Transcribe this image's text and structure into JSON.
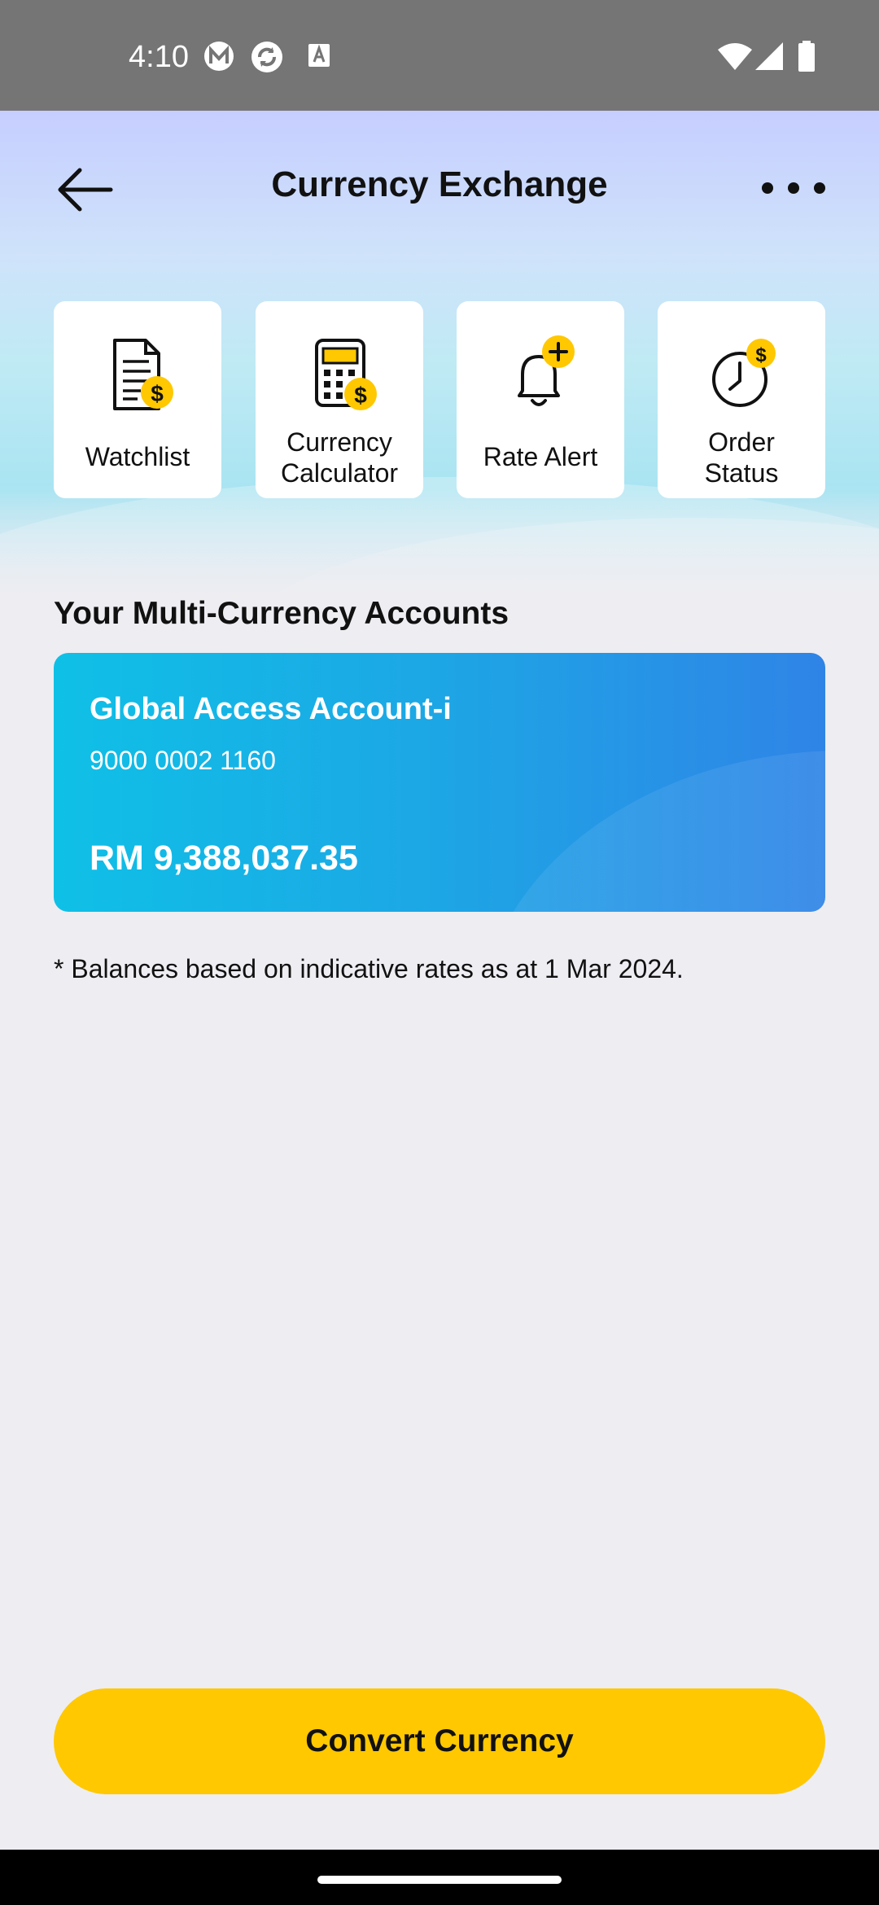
{
  "status_bar": {
    "time": "4:10",
    "left_icons": [
      "m-app-icon",
      "sync-app-icon",
      "font-app-icon"
    ],
    "right_icons": [
      "wifi-icon",
      "signal-icon",
      "battery-icon"
    ]
  },
  "header": {
    "title": "Currency Exchange",
    "back_icon": "arrow-left-icon",
    "more_icon": "more-horizontal-icon"
  },
  "quick_actions": [
    {
      "label_line1": "Watchlist",
      "label_line2": "",
      "icon": "document-dollar-icon"
    },
    {
      "label_line1": "Currency",
      "label_line2": "Calculator",
      "icon": "calculator-dollar-icon"
    },
    {
      "label_line1": "Rate Alert",
      "label_line2": "",
      "icon": "bell-plus-icon"
    },
    {
      "label_line1": "Order",
      "label_line2": "Status",
      "icon": "clock-dollar-icon"
    }
  ],
  "accounts_section": {
    "title": "Your Multi-Currency Accounts",
    "accounts": [
      {
        "name": "Global Access Account-i",
        "number": "9000 0002 1160",
        "balance": "RM 9,388,037.35"
      }
    ],
    "note": "* Balances based on indicative rates as at 1 Mar 2024."
  },
  "actions": {
    "convert_label": "Convert Currency"
  },
  "colors": {
    "accent_yellow": "#FFC800",
    "card_start": "#0FC0E6",
    "card_end": "#2F84E6",
    "background": "#EEEDF2",
    "status_bar": "#757575"
  }
}
